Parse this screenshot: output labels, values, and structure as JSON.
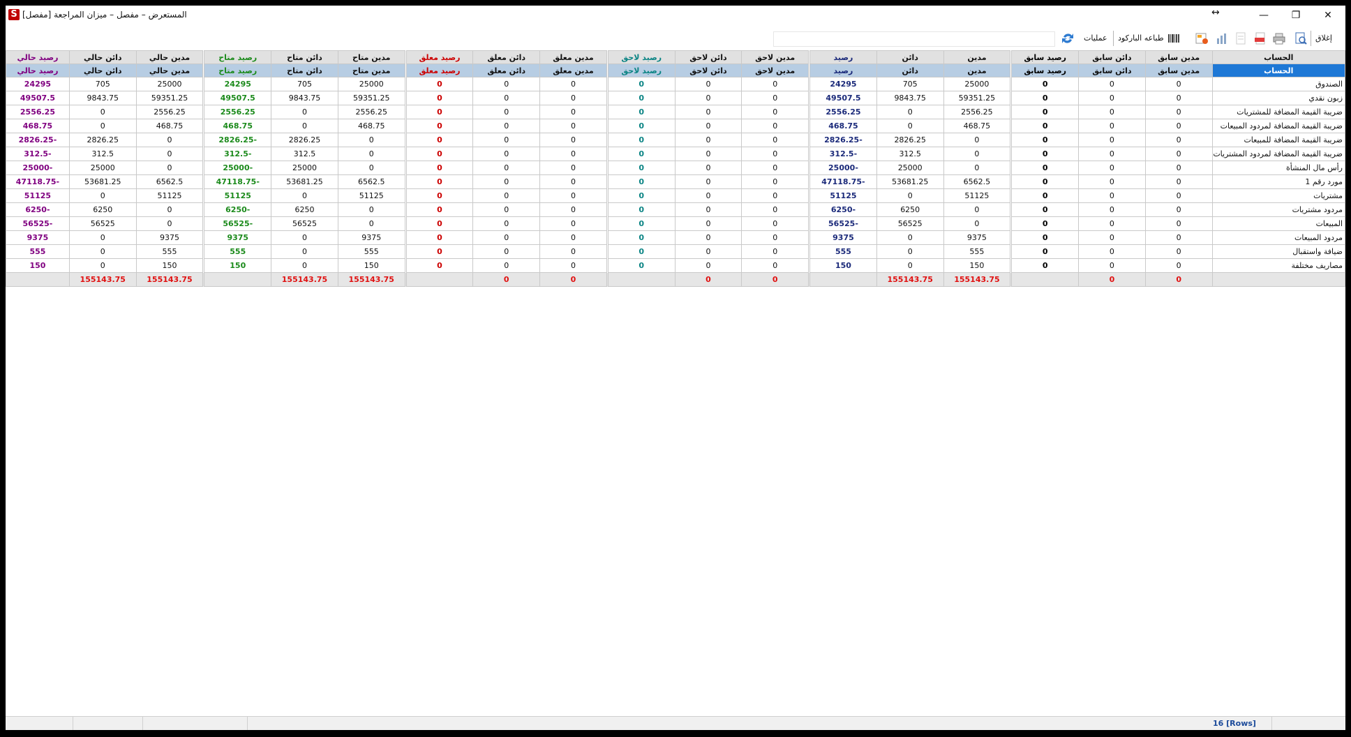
{
  "window": {
    "title": "المستعرض – مفصل – ميزان المراجعة [مفصل]"
  },
  "toolbar": {
    "close_label": "إغلاق",
    "barcode_label": "طباعه الباركود",
    "ops_label": "عمليات",
    "search_value": ""
  },
  "columns_row1": [
    "الحساب",
    "مدين سابق",
    "دائن سابق",
    "رصيد سابق",
    "مدين",
    "دائن",
    "رصيد",
    "مدين لاحق",
    "دائن لاحق",
    "رصيد لاحق",
    "مدين معلق",
    "دائن معلق",
    "رصيد معلق",
    "مدين متاح",
    "دائن متاح",
    "رصيد متاح",
    "مدين حالي",
    "دائن حالي",
    "رصيد حالي"
  ],
  "columns_row2": [
    "الحساب",
    "مدين سابق",
    "دائن سابق",
    "رصيد سابق",
    "مدين",
    "دائن",
    "رصيد",
    "مدين لاحق",
    "دائن لاحق",
    "رصيد لاحق",
    "مدين معلق",
    "دائن معلق",
    "رصيد معلق",
    "مدين متاح",
    "دائن متاح",
    "رصيد متاح",
    "مدين حالي",
    "دائن حالي",
    "رصيد حالي"
  ],
  "rows": [
    [
      "الصندوق",
      "0",
      "0",
      "0",
      "25000",
      "705",
      "24295",
      "0",
      "0",
      "0",
      "0",
      "0",
      "0",
      "25000",
      "705",
      "24295",
      "25000",
      "705",
      "24295"
    ],
    [
      "زبون نقدي",
      "0",
      "0",
      "0",
      "59351.25",
      "9843.75",
      "49507.5",
      "0",
      "0",
      "0",
      "0",
      "0",
      "0",
      "59351.25",
      "9843.75",
      "49507.5",
      "59351.25",
      "9843.75",
      "49507.5"
    ],
    [
      "ضريبة القيمة المضافة للمشتريات",
      "0",
      "0",
      "0",
      "2556.25",
      "0",
      "2556.25",
      "0",
      "0",
      "0",
      "0",
      "0",
      "0",
      "2556.25",
      "0",
      "2556.25",
      "2556.25",
      "0",
      "2556.25"
    ],
    [
      "ضريبة القيمة المضافة لمردود المبيعات",
      "0",
      "0",
      "0",
      "468.75",
      "0",
      "468.75",
      "0",
      "0",
      "0",
      "0",
      "0",
      "0",
      "468.75",
      "0",
      "468.75",
      "468.75",
      "0",
      "468.75"
    ],
    [
      "ضريبة القيمة المضافة للمبيعات",
      "0",
      "0",
      "0",
      "0",
      "2826.25",
      "-2826.25",
      "0",
      "0",
      "0",
      "0",
      "0",
      "0",
      "0",
      "2826.25",
      "-2826.25",
      "0",
      "2826.25",
      "-2826.25"
    ],
    [
      "ضريبة القيمة المضافة لمردود المشتريات",
      "0",
      "0",
      "0",
      "0",
      "312.5",
      "-312.5",
      "0",
      "0",
      "0",
      "0",
      "0",
      "0",
      "0",
      "312.5",
      "-312.5",
      "0",
      "312.5",
      "-312.5"
    ],
    [
      "رأس مال المنشأة",
      "0",
      "0",
      "0",
      "0",
      "25000",
      "-25000",
      "0",
      "0",
      "0",
      "0",
      "0",
      "0",
      "0",
      "25000",
      "-25000",
      "0",
      "25000",
      "-25000"
    ],
    [
      "مورد رقم 1",
      "0",
      "0",
      "0",
      "6562.5",
      "53681.25",
      "-47118.75",
      "0",
      "0",
      "0",
      "0",
      "0",
      "0",
      "6562.5",
      "53681.25",
      "-47118.75",
      "6562.5",
      "53681.25",
      "-47118.75"
    ],
    [
      "مشتريات",
      "0",
      "0",
      "0",
      "51125",
      "0",
      "51125",
      "0",
      "0",
      "0",
      "0",
      "0",
      "0",
      "51125",
      "0",
      "51125",
      "51125",
      "0",
      "51125"
    ],
    [
      "مردود مشتريات",
      "0",
      "0",
      "0",
      "0",
      "6250",
      "-6250",
      "0",
      "0",
      "0",
      "0",
      "0",
      "0",
      "0",
      "6250",
      "-6250",
      "0",
      "6250",
      "-6250"
    ],
    [
      "المبيعات",
      "0",
      "0",
      "0",
      "0",
      "56525",
      "-56525",
      "0",
      "0",
      "0",
      "0",
      "0",
      "0",
      "0",
      "56525",
      "-56525",
      "0",
      "56525",
      "-56525"
    ],
    [
      "مردود المبيعات",
      "0",
      "0",
      "0",
      "9375",
      "0",
      "9375",
      "0",
      "0",
      "0",
      "0",
      "0",
      "0",
      "9375",
      "0",
      "9375",
      "9375",
      "0",
      "9375"
    ],
    [
      "ضيافة واستقبال",
      "0",
      "0",
      "0",
      "555",
      "0",
      "555",
      "0",
      "0",
      "0",
      "0",
      "0",
      "0",
      "555",
      "0",
      "555",
      "555",
      "0",
      "555"
    ],
    [
      "مصاريف مختلفة",
      "0",
      "0",
      "0",
      "150",
      "0",
      "150",
      "0",
      "0",
      "0",
      "0",
      "0",
      "0",
      "150",
      "0",
      "150",
      "150",
      "0",
      "150"
    ]
  ],
  "totals": [
    "",
    "0",
    "0",
    "",
    "155143.75",
    "155143.75",
    "",
    "0",
    "0",
    "",
    "0",
    "0",
    "",
    "155143.75",
    "155143.75",
    "",
    "155143.75",
    "155143.75",
    ""
  ],
  "status": {
    "rows_count": "16 [Rows]"
  },
  "colors": {
    "balance_prev": "#000000",
    "balance": "#1b2a7a",
    "balance_later": "#0b8484",
    "balance_pending": "#cc0000",
    "balance_avail": "#1b8a1b",
    "balance_current": "#800080",
    "header_selected": "#1e78d6"
  }
}
